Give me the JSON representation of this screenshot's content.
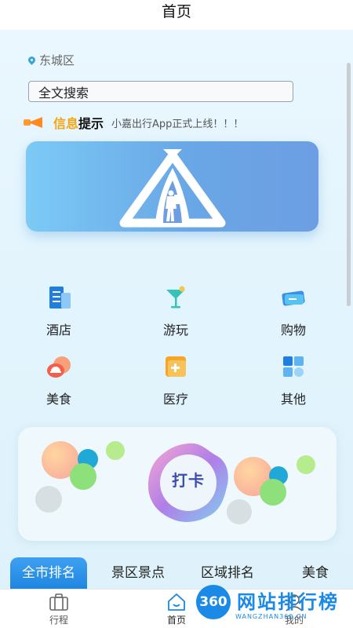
{
  "header": {
    "title": "首页"
  },
  "location": {
    "text": "东城区"
  },
  "search": {
    "value": "全文搜索"
  },
  "notice": {
    "label_highlight": "信息",
    "label_rest": "提示",
    "message": "小嘉出行App正式上线！！！"
  },
  "categories": [
    {
      "label": "酒店",
      "icon": "hotel-icon"
    },
    {
      "label": "游玩",
      "icon": "cocktail-icon"
    },
    {
      "label": "购物",
      "icon": "ticket-icon"
    },
    {
      "label": "美食",
      "icon": "food-dome-icon"
    },
    {
      "label": "医疗",
      "icon": "medical-kit-icon"
    },
    {
      "label": "其他",
      "icon": "grid-icon"
    }
  ],
  "checkin": {
    "label": "打卡"
  },
  "tabs": [
    {
      "label": "全市排名",
      "active": true
    },
    {
      "label": "景区景点",
      "active": false
    },
    {
      "label": "区域排名",
      "active": false
    },
    {
      "label": "美食",
      "active": false
    }
  ],
  "bottom_nav": [
    {
      "label": "行程",
      "icon": "suitcase-icon"
    },
    {
      "label": "首页",
      "icon": "home-icon",
      "active": true
    },
    {
      "label": "我的",
      "icon": "profile-icon"
    }
  ],
  "watermark": {
    "badge": "360",
    "title": "网站排行榜",
    "subtitle": "WANGZHAN360.CN"
  },
  "colors": {
    "accent": "#1f86e0",
    "notice_highlight": "#f4a511",
    "banner": "#6ea6e6"
  }
}
